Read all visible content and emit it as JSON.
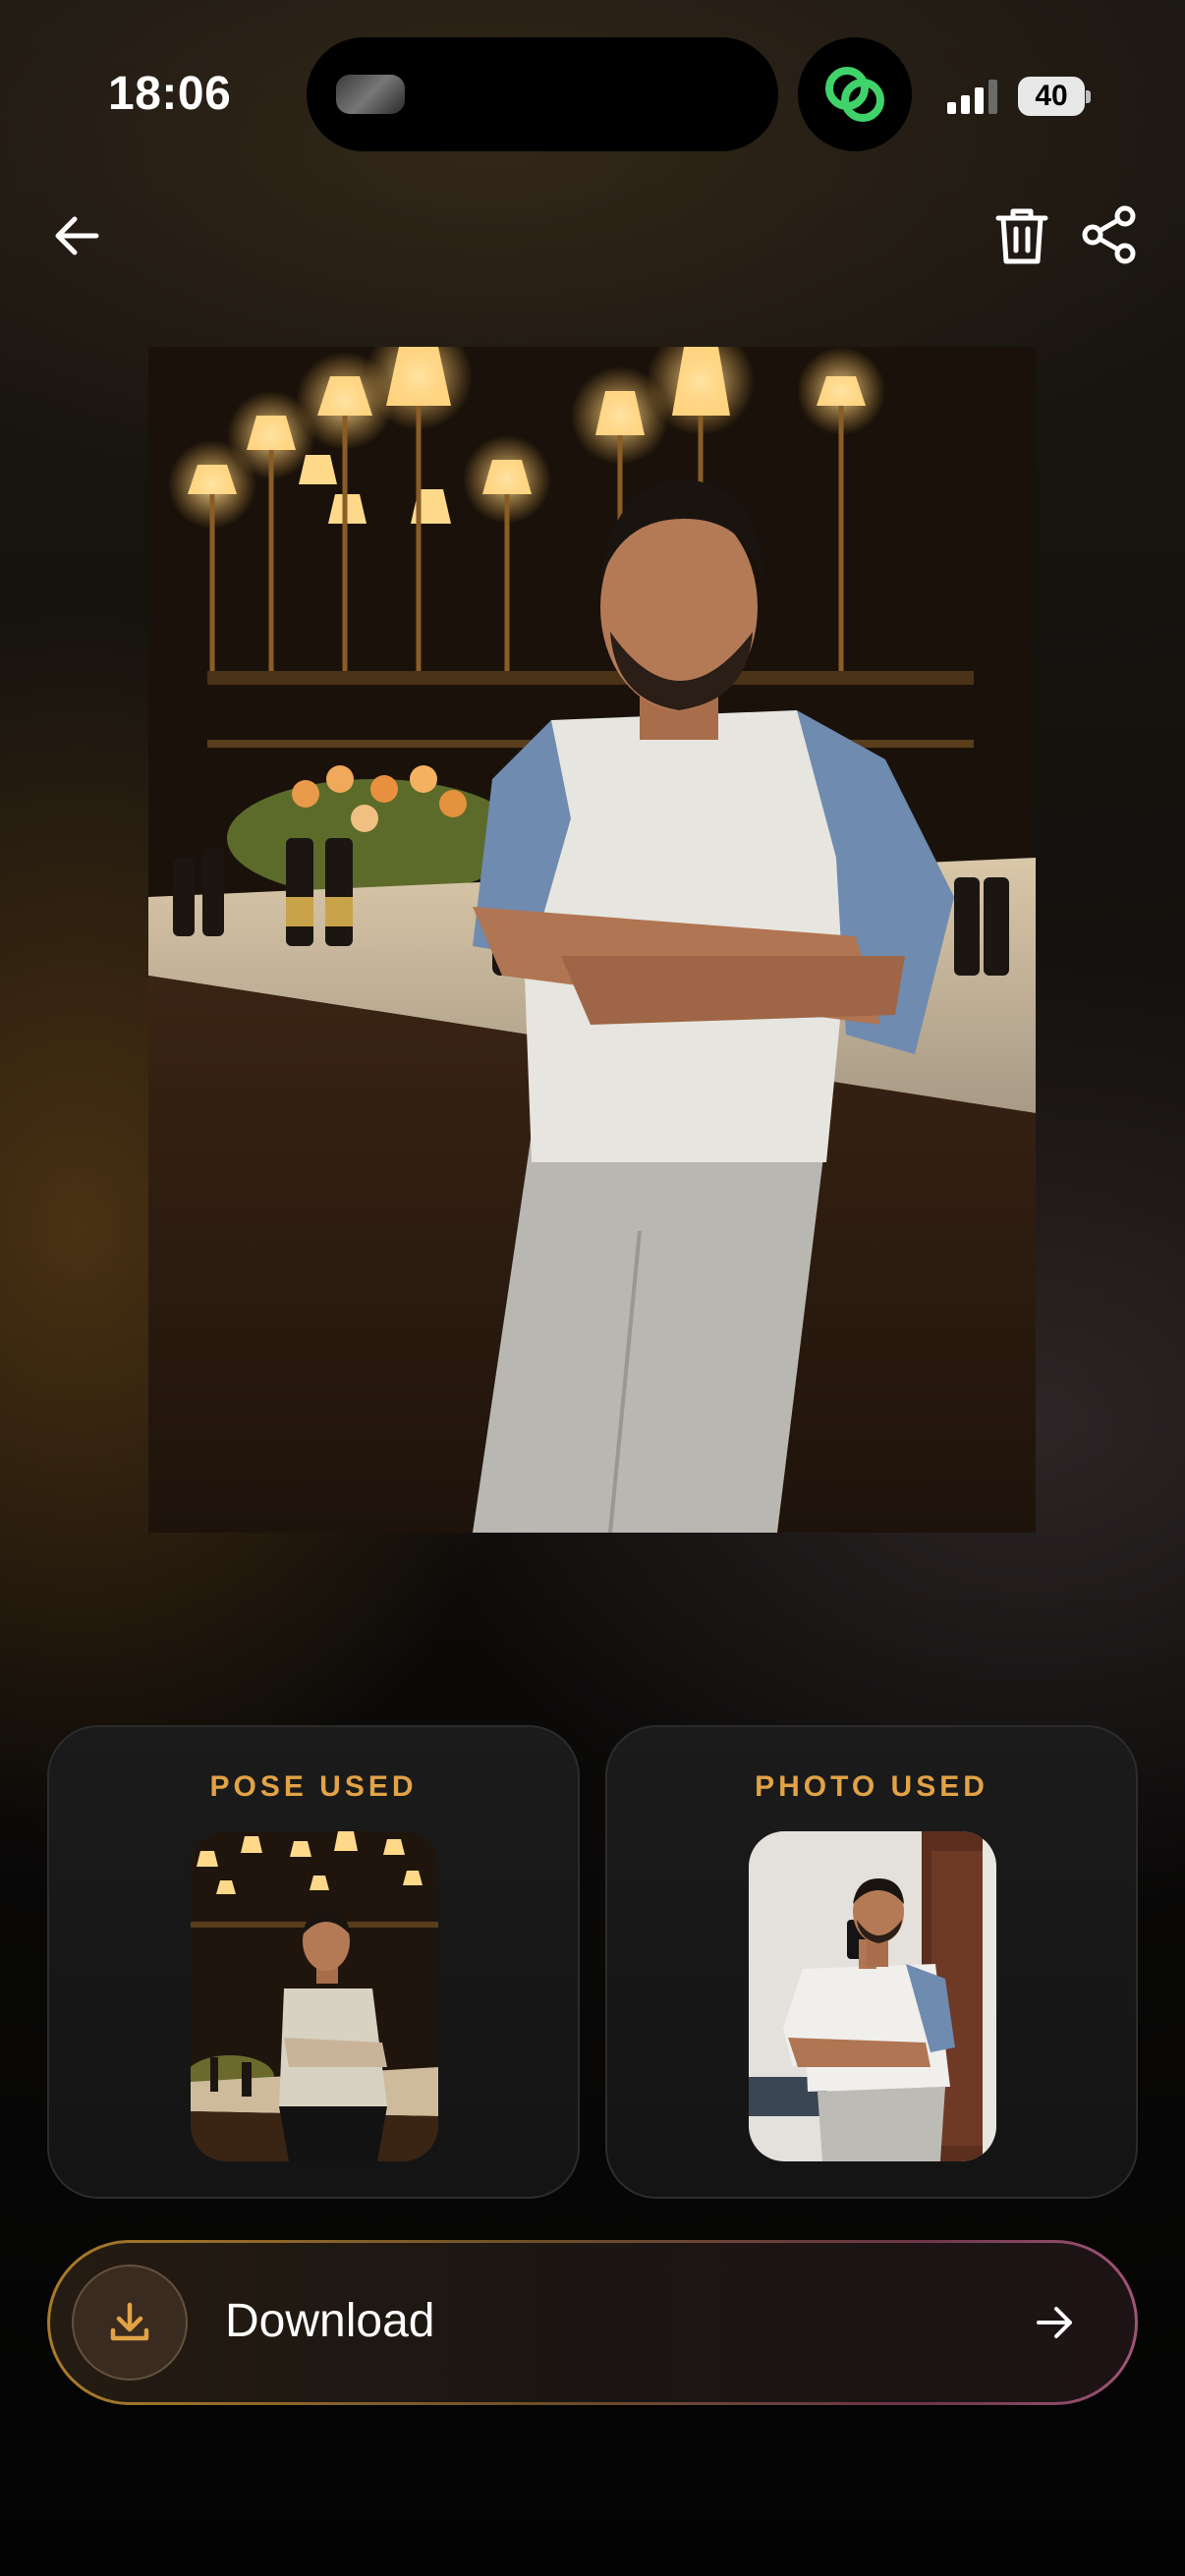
{
  "status_bar": {
    "time": "18:06",
    "battery_level": "40",
    "app_icon": "green-link-icon"
  },
  "toolbar": {
    "back_icon": "arrow-left-icon",
    "delete_icon": "trash-icon",
    "share_icon": "share-icon"
  },
  "main_image": {
    "subject": "man-leaning-on-bar-counter-photo"
  },
  "references": {
    "pose_title": "POSE USED",
    "photo_title": "PHOTO USED"
  },
  "download": {
    "label": "Download",
    "icon": "download-icon",
    "arrow_icon": "arrow-right-icon"
  },
  "colors": {
    "accent_gold": "#e2a246",
    "app_green": "#3fd36a"
  }
}
